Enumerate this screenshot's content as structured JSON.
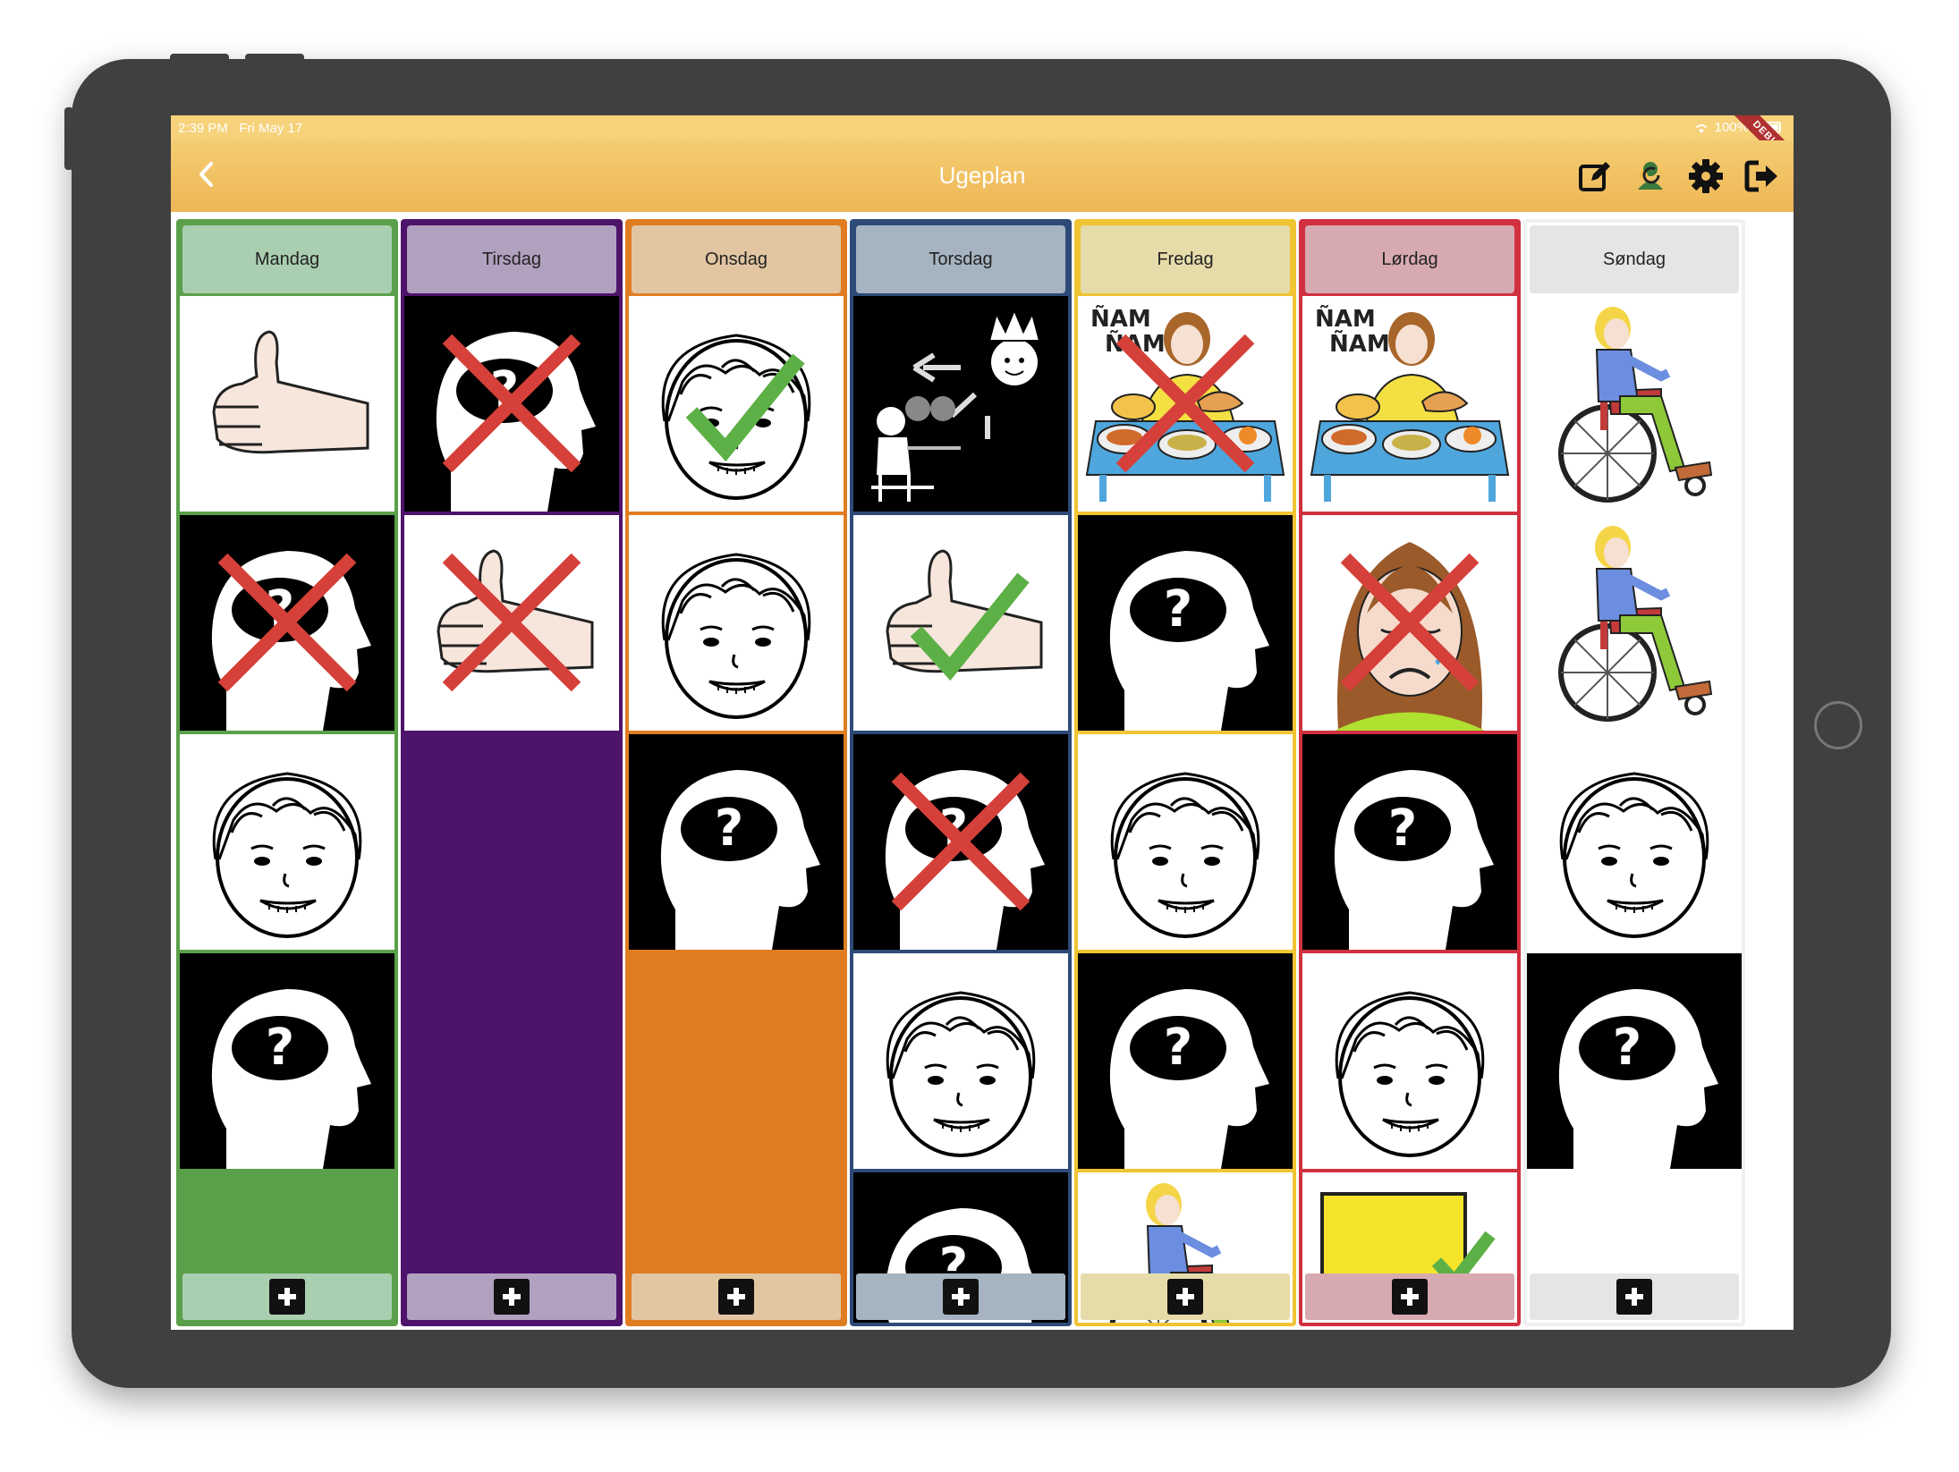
{
  "status": {
    "time": "2:39 PM",
    "date": "Fri May 17",
    "battery": "100%",
    "debug_banner": "DEBUG"
  },
  "appbar": {
    "title": "Ugeplan",
    "back_icon": "chevron-left-icon",
    "actions": [
      "edit-icon",
      "guardian-switch-icon",
      "settings-gear-icon",
      "logout-icon"
    ]
  },
  "columns": [
    {
      "day": "Mandag",
      "accent": "#5aa04a",
      "header_bg": "#a9ceb0",
      "fill": "#5aa04a",
      "tiles": [
        "thumbs-up",
        "question-head-x",
        "smiling-boy",
        "question-head"
      ]
    },
    {
      "day": "Tirsdag",
      "accent": "#4e136b",
      "header_bg": "#b2a0bf",
      "fill": "#4e136b",
      "tiles": [
        "question-head-x",
        "thumbs-up-x"
      ]
    },
    {
      "day": "Onsdag",
      "accent": "#e07d22",
      "header_bg": "#e2c6a2",
      "fill": "#e07d22",
      "tiles": [
        "smiling-boy-check",
        "smiling-boy",
        "question-head"
      ]
    },
    {
      "day": "Torsdag",
      "accent": "#2d4a78",
      "header_bg": "#a6b3c0",
      "fill": "#2d4a78",
      "tiles": [
        "classroom-king",
        "thumbs-up-check",
        "question-head-x",
        "smiling-boy",
        "question-head"
      ]
    },
    {
      "day": "Fredag",
      "accent": "#f0c432",
      "header_bg": "#e6dcaa",
      "fill": "#f0c432",
      "tiles": [
        "eating-girl-x",
        "question-head",
        "smiling-boy",
        "question-head",
        "wheelchair-girl"
      ]
    },
    {
      "day": "Lørdag",
      "accent": "#d03040",
      "header_bg": "#d7a9b0",
      "fill": "#d03040",
      "tiles": [
        "eating-girl",
        "sad-girl-x",
        "question-head",
        "smiling-boy",
        "yellow-board-check"
      ]
    },
    {
      "day": "Søndag",
      "accent": "#f0f0f0",
      "header_bg": "#e5e5e5",
      "fill": "#ffffff",
      "tiles": [
        "wheelchair-girl",
        "wheelchair-girl",
        "smiling-boy",
        "question-head"
      ]
    }
  ],
  "add_button_icon": "plus-icon"
}
